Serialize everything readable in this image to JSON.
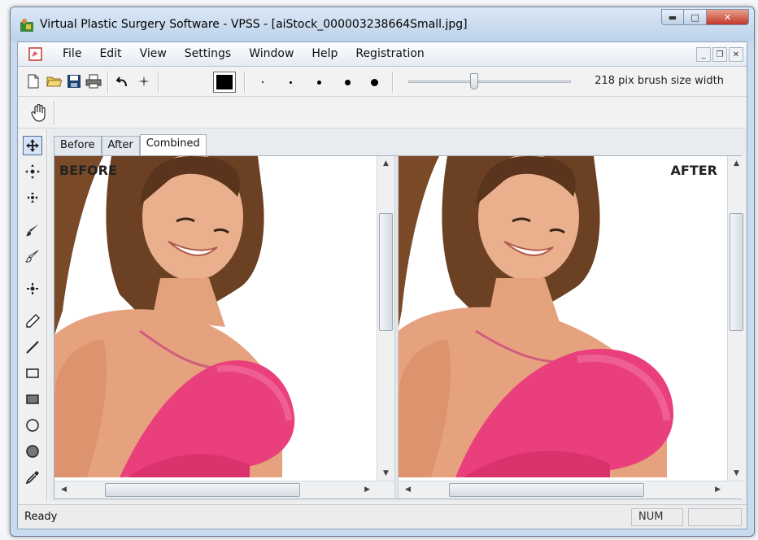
{
  "window": {
    "title": "Virtual Plastic Surgery Software - VPSS - [aiStock_000003238664Small.jpg]",
    "caption_buttons": [
      "minimize",
      "maximize",
      "close"
    ]
  },
  "menu": {
    "items": [
      "File",
      "Edit",
      "View",
      "Settings",
      "Window",
      "Help",
      "Registration"
    ]
  },
  "toolbar": {
    "brush_size_label": "218 pix brush size width",
    "brush_size_value": 218,
    "brush_slider_fraction": 0.38,
    "current_color": "#000000",
    "icons": [
      "new-document-icon",
      "open-folder-icon",
      "save-icon",
      "print-icon",
      "undo-icon",
      "sparkle-icon"
    ]
  },
  "tabs": [
    {
      "label": "Before",
      "active": false
    },
    {
      "label": "After",
      "active": false
    },
    {
      "label": "Combined",
      "active": true
    }
  ],
  "panes": {
    "before_label": "BEFORE",
    "after_label": "AFTER"
  },
  "left_tools": [
    "move-icon",
    "grow-icon",
    "shrink-icon",
    "brush-icon",
    "brush-alt-icon",
    "pinch-icon",
    "pencil-icon",
    "line-icon",
    "rectangle-icon",
    "filled-rectangle-icon",
    "ellipse-icon",
    "filled-ellipse-icon",
    "eyedropper-icon"
  ],
  "statusbar": {
    "status": "Ready",
    "num": "NUM"
  },
  "colors": {
    "accent": "#4a6d9a",
    "bra_pink": "#ea3f7d",
    "skin": "#e7a37f",
    "hair": "#6b4023"
  }
}
